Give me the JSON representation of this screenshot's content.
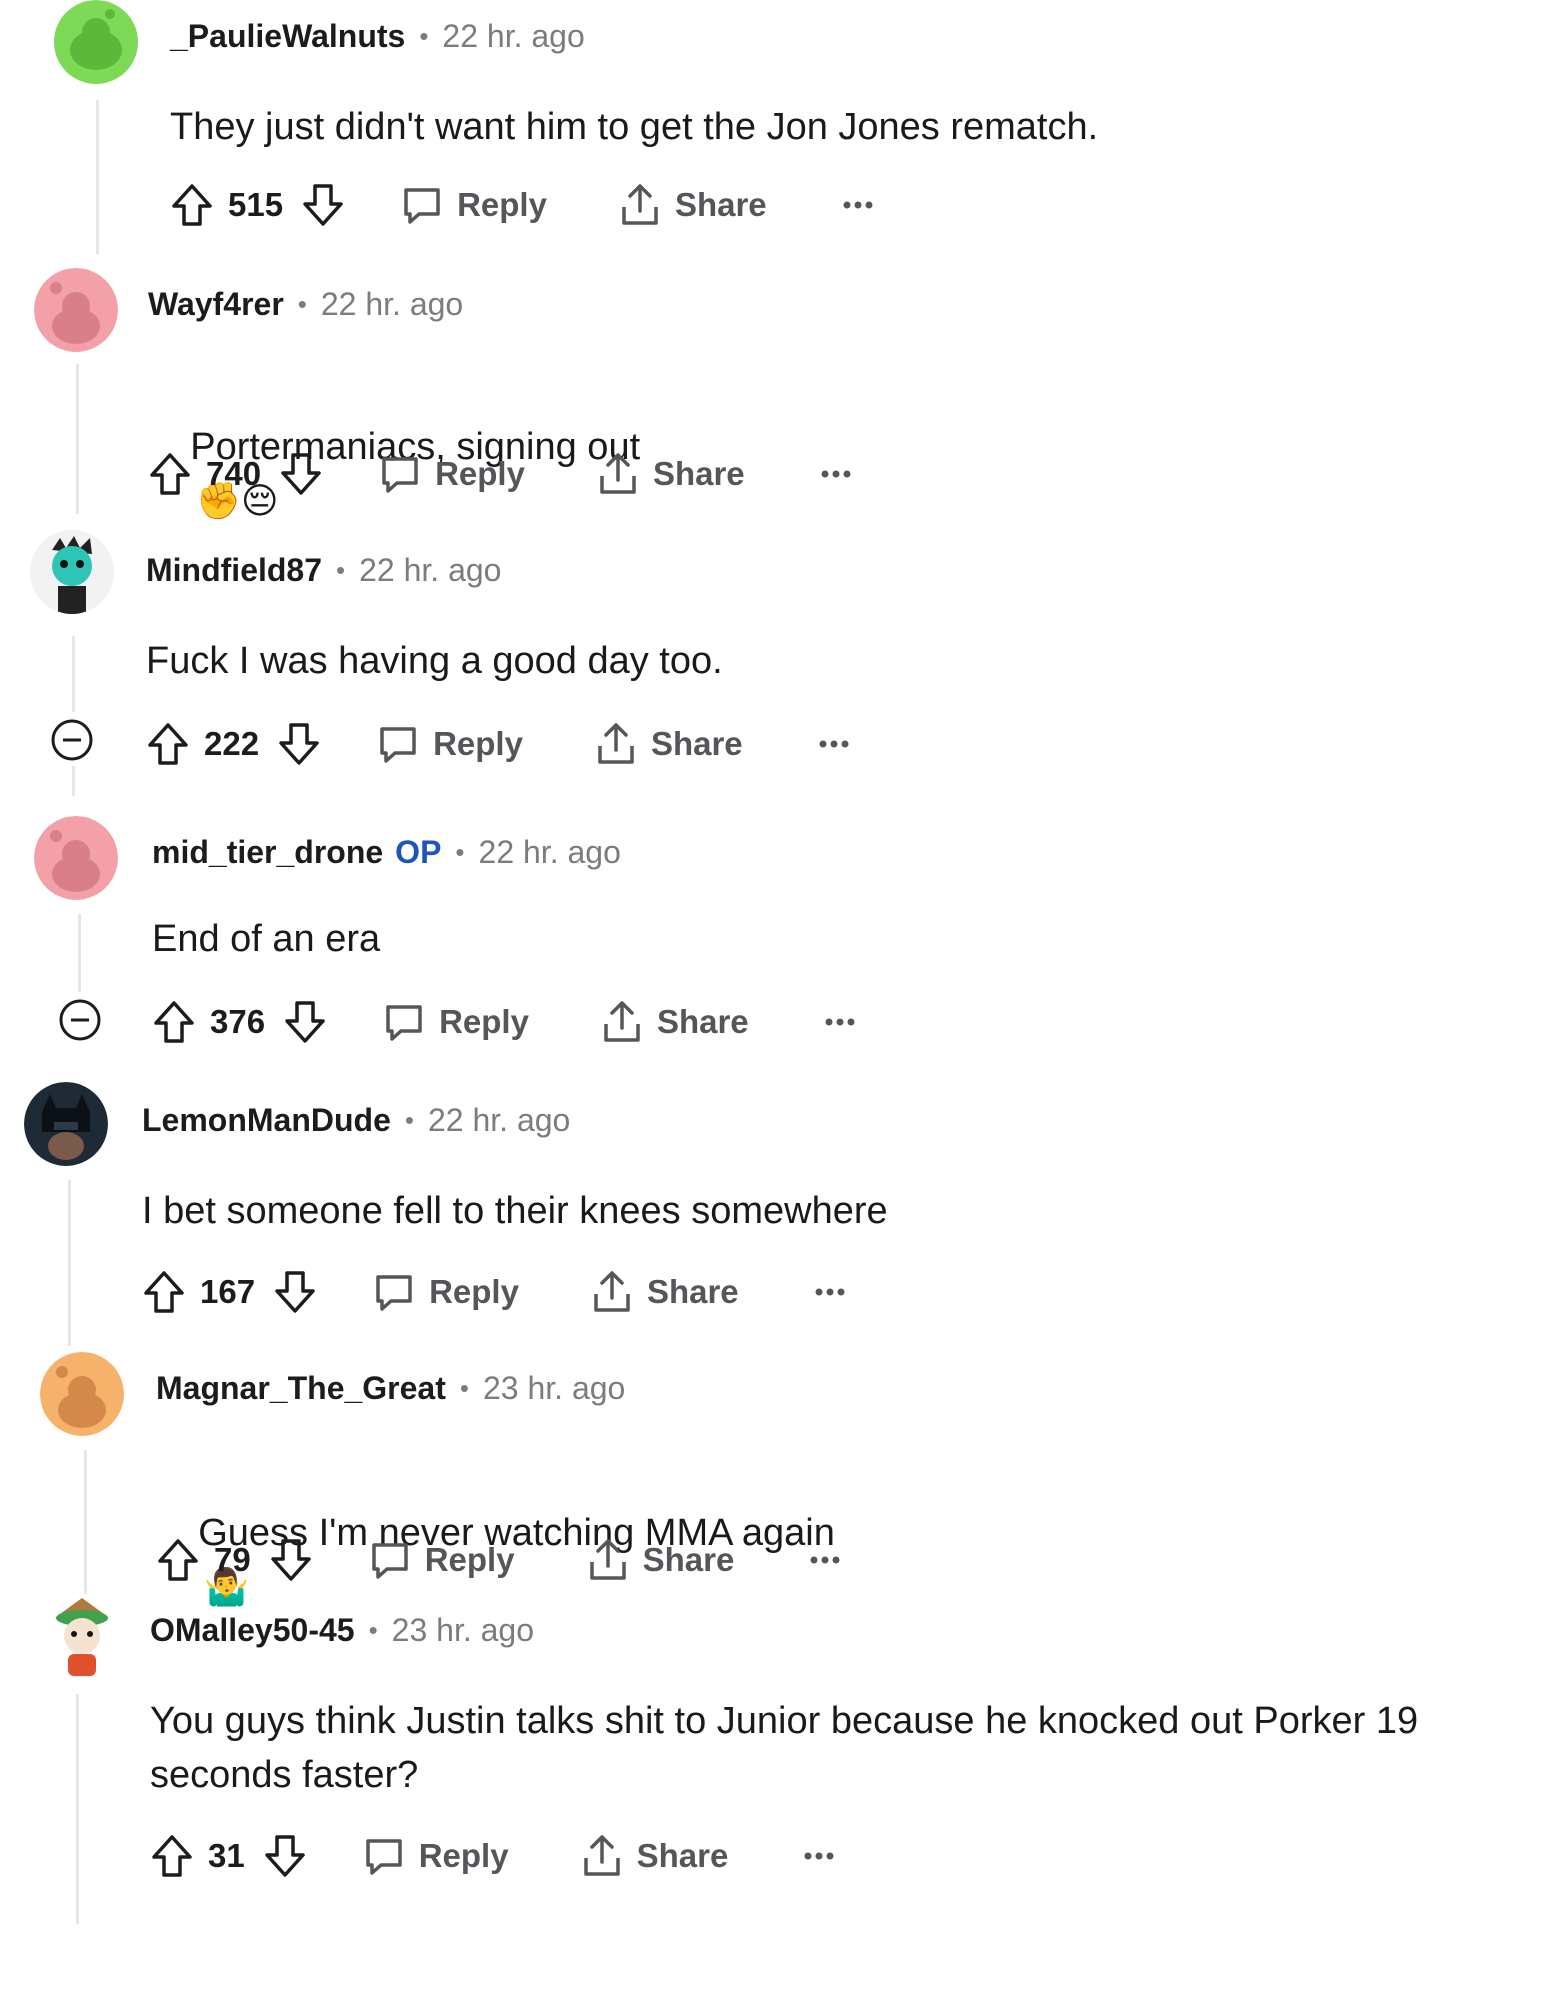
{
  "comments": [
    {
      "username": "_PaulieWalnuts",
      "time": "22 hr. ago",
      "text": "They just didn't want him to get the Jon Jones rematch.",
      "score": "515",
      "reply_label": "Reply",
      "share_label": "Share",
      "avatar_color": "#7ed957"
    },
    {
      "username": "Wayf4rer",
      "time": "22 hr. ago",
      "text": "Portermaniacs, signing out",
      "emoji": "✊😔",
      "score": "740",
      "reply_label": "Reply",
      "share_label": "Share",
      "avatar_color": "#f4a0a8"
    },
    {
      "username": "Mindfield87",
      "time": "22 hr. ago",
      "text": "Fuck I was having a good day too.",
      "score": "222",
      "reply_label": "Reply",
      "share_label": "Share",
      "avatar_color": "#2ec4b6"
    },
    {
      "username": "mid_tier_drone",
      "op_badge": "OP",
      "time": "22 hr. ago",
      "text": "End of an era",
      "score": "376",
      "reply_label": "Reply",
      "share_label": "Share",
      "avatar_color": "#f4a0a8"
    },
    {
      "username": "LemonManDude",
      "time": "22 hr. ago",
      "text": "I bet someone fell to their knees somewhere",
      "score": "167",
      "reply_label": "Reply",
      "share_label": "Share",
      "avatar_color": "#1e2a36"
    },
    {
      "username": "Magnar_The_Great",
      "time": "23 hr. ago",
      "text": "Guess I'm never watching MMA again",
      "emoji": "🤷‍♂️",
      "score": "79",
      "reply_label": "Reply",
      "share_label": "Share",
      "avatar_color": "#f6b26b"
    },
    {
      "username": "OMalley50-45",
      "time": "23 hr. ago",
      "text": "You guys think Justin talks shit to Junior because he knocked out Porker 19\nseconds faster?",
      "score": "31",
      "reply_label": "Reply",
      "share_label": "Share",
      "avatar_color": "#ffffff"
    }
  ],
  "icons": {
    "upvote": "upvote-arrow-icon",
    "downvote": "downvote-arrow-icon",
    "reply": "speech-bubble-icon",
    "share": "share-upload-icon",
    "more": "ellipsis-icon",
    "collapse": "collapse-minus-icon"
  }
}
